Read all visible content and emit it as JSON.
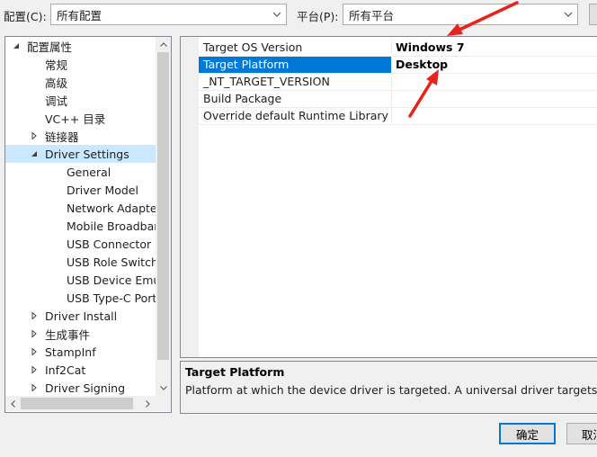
{
  "header": {
    "config_label": "配置(C):",
    "config_value": "所有配置",
    "platform_label": "平台(P):",
    "platform_value": "所有平台"
  },
  "tree": {
    "items": [
      {
        "label": "配置属性",
        "level": 0,
        "toggle": "expanded"
      },
      {
        "label": "常规",
        "level": 1,
        "toggle": "none"
      },
      {
        "label": "高级",
        "level": 1,
        "toggle": "none"
      },
      {
        "label": "调试",
        "level": 1,
        "toggle": "none"
      },
      {
        "label": "VC++ 目录",
        "level": 1,
        "toggle": "none"
      },
      {
        "label": "链接器",
        "level": 1,
        "toggle": "collapsed"
      },
      {
        "label": "Driver Settings",
        "level": 1,
        "toggle": "expanded",
        "selected": true
      },
      {
        "label": "General",
        "level": 2,
        "toggle": "none"
      },
      {
        "label": "Driver Model",
        "level": 2,
        "toggle": "none"
      },
      {
        "label": "Network Adapter",
        "level": 2,
        "toggle": "none"
      },
      {
        "label": "Mobile Broadband",
        "level": 2,
        "toggle": "none"
      },
      {
        "label": "USB Connector M",
        "level": 2,
        "toggle": "none"
      },
      {
        "label": "USB Role Switch D",
        "level": 2,
        "toggle": "none"
      },
      {
        "label": "USB Device Emula",
        "level": 2,
        "toggle": "none"
      },
      {
        "label": "USB Type-C Port C",
        "level": 2,
        "toggle": "none"
      },
      {
        "label": "Driver Install",
        "level": 1,
        "toggle": "collapsed"
      },
      {
        "label": "生成事件",
        "level": 1,
        "toggle": "collapsed"
      },
      {
        "label": "StampInf",
        "level": 1,
        "toggle": "collapsed"
      },
      {
        "label": "Inf2Cat",
        "level": 1,
        "toggle": "collapsed"
      },
      {
        "label": "Driver Signing",
        "level": 1,
        "toggle": "collapsed"
      }
    ]
  },
  "grid": {
    "rows": [
      {
        "name": "Target OS Version",
        "value": "Windows 7"
      },
      {
        "name": "Target Platform",
        "value": "Desktop",
        "selected": true
      },
      {
        "name": "_NT_TARGET_VERSION",
        "value": ""
      },
      {
        "name": "Build Package",
        "value": ""
      },
      {
        "name": "Override default Runtime Library",
        "value": ""
      }
    ]
  },
  "description": {
    "title": "Target Platform",
    "text": "Platform at which the device driver is targeted. A universal driver targets all Wi"
  },
  "buttons": {
    "ok": "确定",
    "cancel": "取消"
  },
  "colors": {
    "selection": "#0078d7",
    "tree_selection": "#cce8ff",
    "annotation_arrow": "#e8231b"
  }
}
